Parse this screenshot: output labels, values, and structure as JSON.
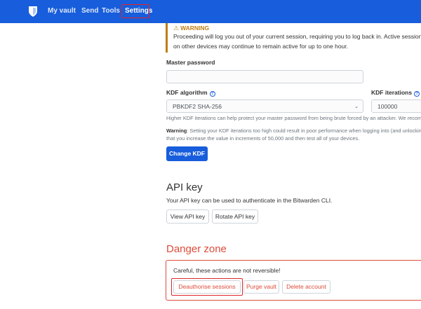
{
  "nav": {
    "links": [
      "My vault",
      "Send",
      "Tools",
      "Settings"
    ],
    "active": "Settings",
    "color": "#175ddc"
  },
  "warning": {
    "title": "WARNING",
    "icon": "warning-triangle-icon",
    "body": "Proceeding will log you out of your current session, requiring you to log back in. Active sessions on other devices may continue to remain active for up to one hour."
  },
  "kdf": {
    "master_password_label": "Master password",
    "master_password_value": "",
    "algorithm_label": "KDF algorithm",
    "algorithm_value": "PBKDF2 SHA-256",
    "iterations_label": "KDF iterations",
    "iterations_value": "100000",
    "help_text": "Higher KDF iterations can help protect your master password from being brute forced by an attacker. We recommend",
    "warning_label": "Warning",
    "warning_line1": ": Setting your KDF iterations too high could result in poor performance when logging into (and unlocking",
    "warning_line2": "that you increase the value in increments of 50,000 and then test all of your devices.",
    "change_button": "Change KDF"
  },
  "api_key": {
    "title": "API key",
    "description": "Your API key can be used to authenticate in the Bitwarden CLI.",
    "view_button": "View API key",
    "rotate_button": "Rotate API key"
  },
  "danger_zone": {
    "title": "Danger zone",
    "description": "Careful, these actions are not reversible!",
    "deauthorize_button": "Deauthorise sessions",
    "purge_button": "Purge vault",
    "delete_button": "Delete account",
    "color": "#dd4b39"
  }
}
